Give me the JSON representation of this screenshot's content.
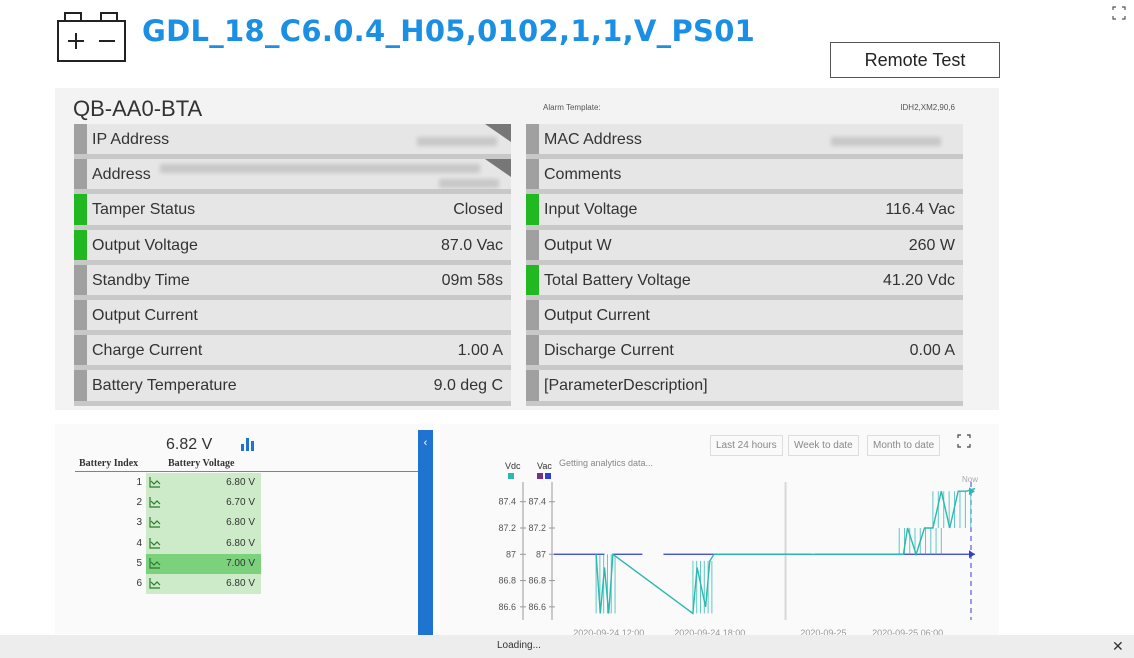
{
  "header": {
    "title": "GDL_18_C6.0.4_H05,0102,1,1,V_PS01",
    "icon": "battery-icon",
    "remote_test_label": "Remote Test",
    "accent_color": "#1a8fe3"
  },
  "device": {
    "name": "QB-AA0-BTA",
    "alarm_template_label": "Alarm Template:",
    "alarm_template_value": "IDH2,XM2,90,6",
    "left_params": [
      {
        "label": "IP Address",
        "value": "",
        "status": "neutral"
      },
      {
        "label": "Address",
        "value": "",
        "status": "neutral"
      },
      {
        "label": "Tamper Status",
        "value": "Closed",
        "status": "ok"
      },
      {
        "label": "Output Voltage",
        "value": "87.0 Vac",
        "status": "ok"
      },
      {
        "label": "Standby Time",
        "value": "09m 58s",
        "status": "neutral"
      },
      {
        "label": "Output Current",
        "value": "",
        "status": "neutral"
      },
      {
        "label": "Charge Current",
        "value": "1.00 A",
        "status": "neutral"
      },
      {
        "label": "Battery Temperature",
        "value": "9.0 deg C",
        "status": "neutral"
      }
    ],
    "right_params": [
      {
        "label": "MAC Address",
        "value": "",
        "status": "neutral"
      },
      {
        "label": "Comments",
        "value": "",
        "status": "neutral"
      },
      {
        "label": "Input Voltage",
        "value": "116.4 Vac",
        "status": "ok"
      },
      {
        "label": "Output W",
        "value": "260 W",
        "status": "neutral"
      },
      {
        "label": "Total Battery Voltage",
        "value": "41.20 Vdc",
        "status": "ok"
      },
      {
        "label": "Output Current",
        "value": "",
        "status": "neutral"
      },
      {
        "label": "Discharge Current",
        "value": "0.00 A",
        "status": "neutral"
      },
      {
        "label": "[ParameterDescription]",
        "value": "",
        "status": "neutral"
      }
    ],
    "status_colors": {
      "ok": "#22b822",
      "neutral": "#a0a0a0"
    }
  },
  "battery": {
    "summary_voltage": "6.82 V",
    "col_index": "Battery Index",
    "col_voltage": "Battery Voltage",
    "rows": [
      {
        "index": "1",
        "voltage": "6.80 V",
        "highlight": false
      },
      {
        "index": "2",
        "voltage": "6.70 V",
        "highlight": false
      },
      {
        "index": "3",
        "voltage": "6.80 V",
        "highlight": false
      },
      {
        "index": "4",
        "voltage": "6.80 V",
        "highlight": false
      },
      {
        "index": "5",
        "voltage": "7.00 V",
        "highlight": true
      },
      {
        "index": "6",
        "voltage": "6.80 V",
        "highlight": false
      }
    ]
  },
  "analytics": {
    "range_buttons": [
      "Last 24 hours",
      "Week to date",
      "Month to date"
    ],
    "status_message": "Getting analytics data...",
    "unit_vdc": "Vdc",
    "unit_vac": "Vac",
    "now_label": "Now",
    "vdc_color": "#2bb8b0",
    "vac_colors": [
      "#7a2f8f",
      "#2f3fcf"
    ],
    "chart_data": {
      "type": "line",
      "x_ticks": [
        "2020-09-24 12:00",
        "2020-09-24 18:00",
        "2020-09-25",
        "2020-09-25 06:00"
      ],
      "y_ticks": [
        "87.4",
        "87.2",
        "87",
        "86.8",
        "86.6"
      ],
      "ylim": [
        86.5,
        87.55
      ],
      "series": [
        {
          "name": "Vac",
          "x": [
            0.0,
            0.12,
            0.21,
            0.26,
            0.3,
            0.61,
            1.0
          ],
          "y": [
            87.0,
            87.0,
            87.0,
            87.0,
            87.0,
            87.0,
            87.0
          ]
        },
        {
          "name": "Vdc",
          "x": [
            0.1,
            0.11,
            0.12,
            0.13,
            0.14,
            0.33,
            0.34,
            0.36,
            0.37,
            0.38,
            0.83,
            0.84,
            0.86,
            0.88,
            0.9,
            0.92,
            0.94,
            0.96,
            0.98,
            1.0
          ],
          "y": [
            87.0,
            86.55,
            86.9,
            86.55,
            87.0,
            86.55,
            86.9,
            86.6,
            86.95,
            87.0,
            87.0,
            87.2,
            87.0,
            87.2,
            87.2,
            87.48,
            87.2,
            87.48,
            87.48,
            87.5
          ]
        }
      ]
    }
  },
  "footer": {
    "loading_text": "Loading..."
  }
}
